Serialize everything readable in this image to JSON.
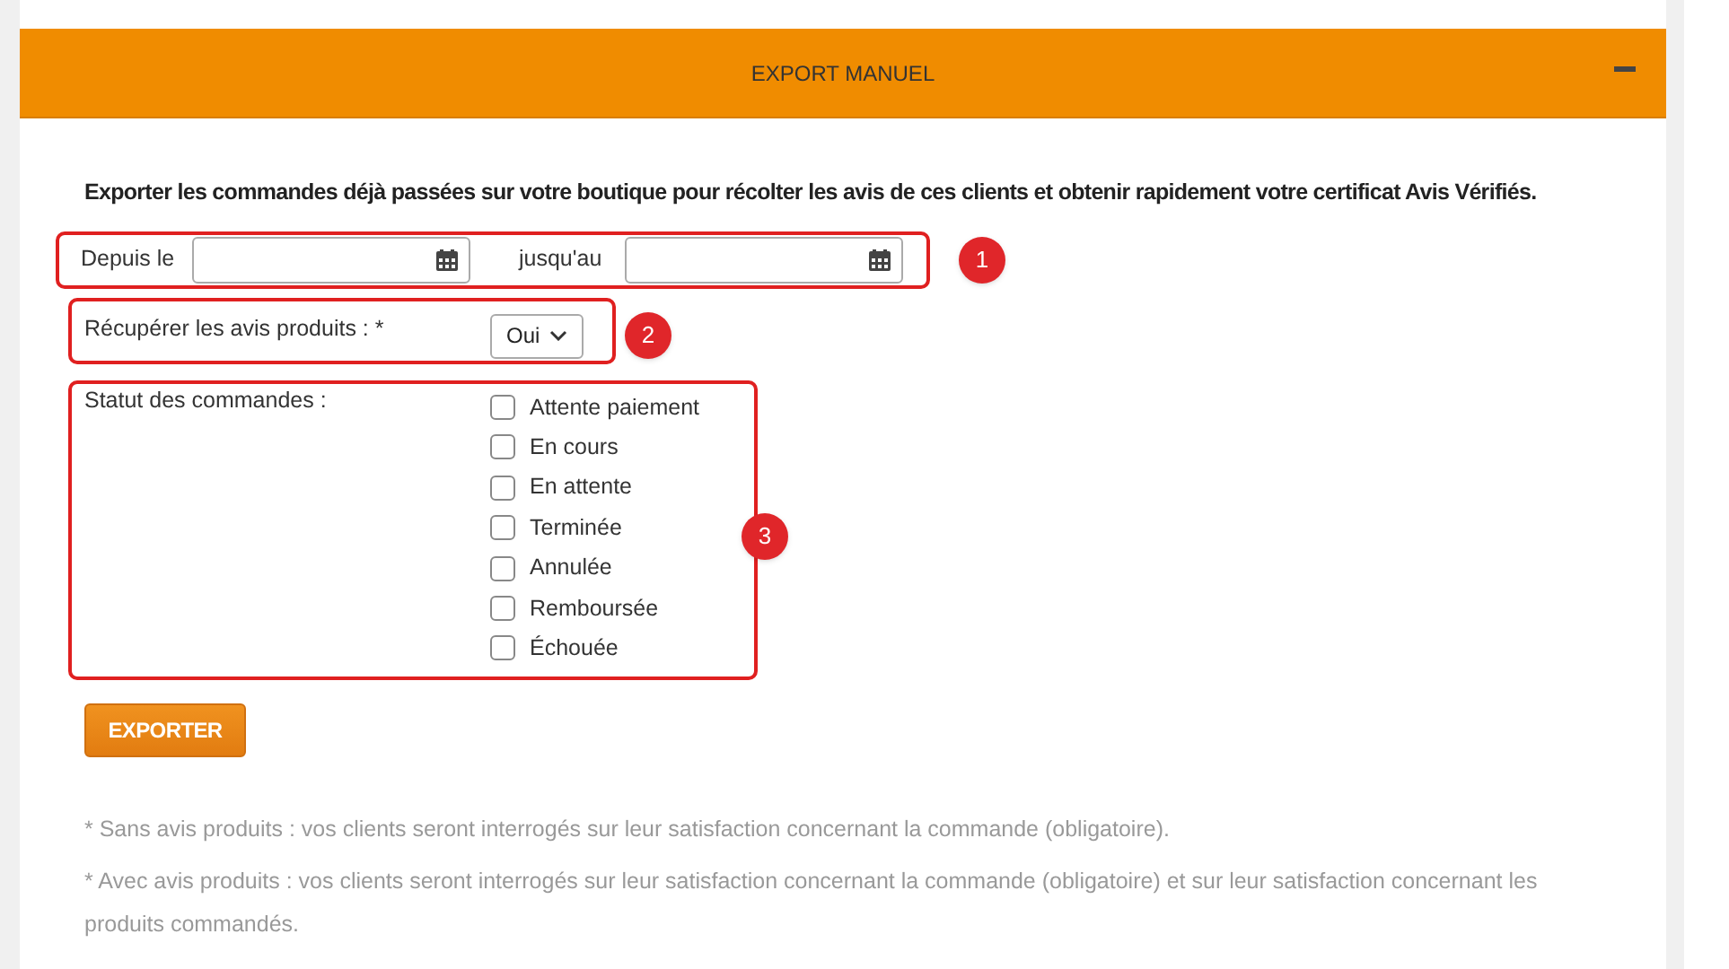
{
  "panel": {
    "title": "EXPORT MANUEL"
  },
  "intro": "Exporter les commandes déjà passées sur votre boutique pour récolter les avis de ces clients et obtenir rapidement votre certificat Avis Vérifiés.",
  "date_range": {
    "from_label": "Depuis le",
    "to_label": "jusqu'au"
  },
  "product_reviews": {
    "label": "Récupérer les avis produits : *",
    "value": "Oui"
  },
  "order_status": {
    "label": "Statut des commandes :",
    "options": [
      {
        "label": "Attente paiement",
        "checked": false
      },
      {
        "label": "En cours",
        "checked": false
      },
      {
        "label": "En attente",
        "checked": false
      },
      {
        "label": "Terminée",
        "checked": false
      },
      {
        "label": "Annulée",
        "checked": false
      },
      {
        "label": "Remboursée",
        "checked": false
      },
      {
        "label": "Échouée",
        "checked": false
      }
    ]
  },
  "button": "EXPORTER",
  "notes": [
    "* Sans avis produits : vos clients seront interrogés sur leur satisfaction concernant la commande (obligatoire).",
    "* Avec avis produits : vos clients seront interrogés sur leur satisfaction concernant la commande (obligatoire) et sur leur satisfaction concernant les produits commandés."
  ],
  "annotations": [
    "1",
    "2",
    "3"
  ]
}
